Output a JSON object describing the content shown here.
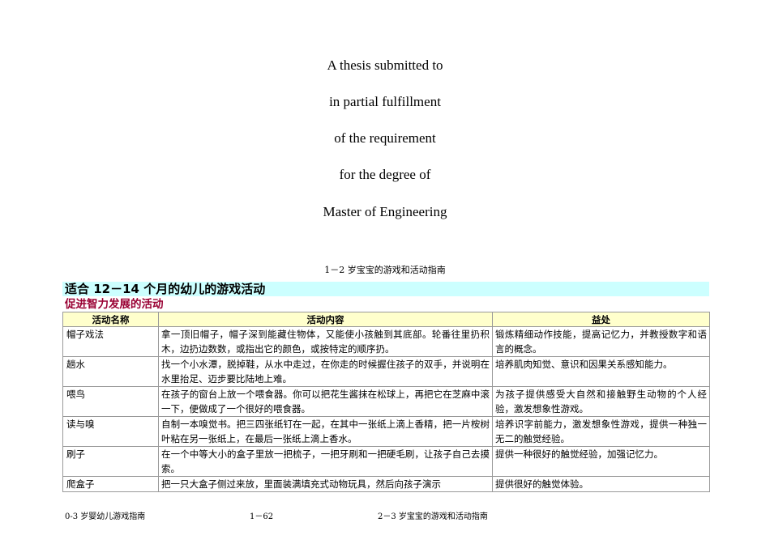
{
  "thesis_lines": [
    "A thesis submitted to",
    "in partial fulfillment",
    "of the requirement",
    "for the degree of",
    "Master of Engineering"
  ],
  "caption": "1－2 岁宝宝的游戏和活动指南",
  "section": {
    "title": "适合 12－14 个月的幼儿的游戏活动",
    "subtitle": "促进智力发展的活动"
  },
  "table": {
    "headers": [
      "活动名称",
      "活动内容",
      "益处"
    ],
    "rows": [
      {
        "name": "帽子戏法",
        "content": "拿一顶旧帽子，帽子深到能藏住物体，又能使小孩触到其底部。轮番往里扔积木，边扔边数数，或指出它的颜色，或按特定的顺序扔。",
        "benefit": "锻炼精细动作技能，提高记忆力，并教授数字和语言的概念。"
      },
      {
        "name": "趟水",
        "content": "找一个小水潭，脱掉鞋，从水中走过，在你走的时候握住孩子的双手，并说明在水里抬足、迈步要比陆地上难。",
        "benefit": "培养肌肉知觉、意识和因果关系感知能力。"
      },
      {
        "name": "喂鸟",
        "content": "在孩子的窗台上放一个喂食器。你可以把花生酱抹在松球上，再把它在芝麻中滚一下，便做成了一个很好的喂食器。",
        "benefit": "为孩子提供感受大自然和接触野生动物的个人经验，激发想象性游戏。"
      },
      {
        "name": "读与嗅",
        "content": "自制一本嗅觉书。把三四张纸钉在一起，在其中一张纸上滴上香精，把一片桉树叶粘在另一张纸上，在最后一张纸上滴上香水。",
        "benefit": "培养识字前能力，激发想象性游戏，提供一种独一无二的触觉经验。"
      },
      {
        "name": "刷子",
        "content": "在一个中等大小的盒子里放一把梳子，一把牙刷和一把硬毛刷，让孩子自己去摸索。",
        "benefit": "提供一种很好的触觉经验，加强记忆力。"
      },
      {
        "name": "爬盒子",
        "content": "把一只大盒子侧过来放，里面装满填充式动物玩具，然后向孩子演示",
        "benefit": "提供很好的触觉体验。"
      }
    ]
  },
  "footer": {
    "left": "0-3 岁婴幼儿游戏指南",
    "page": "1－62",
    "right": "2－3 岁宝宝的游戏和活动指南"
  }
}
